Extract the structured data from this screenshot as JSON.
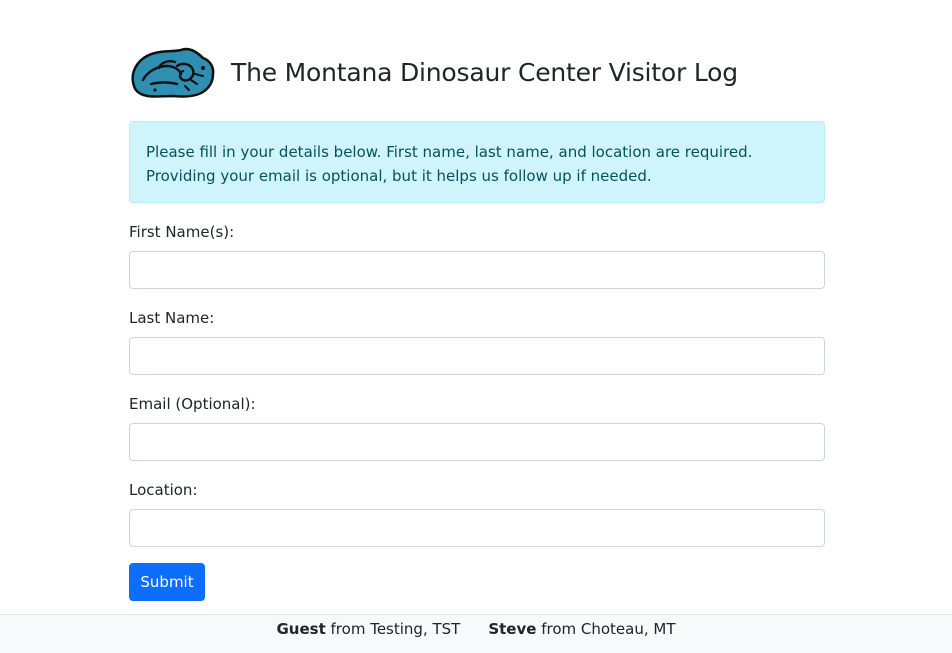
{
  "header": {
    "title": "The Montana Dinosaur Center Visitor Log",
    "logo_icon": "dinosaur-fossil-icon"
  },
  "alert": {
    "text": "Please fill in your details below. First name, last name, and location are required. Providing your email is optional, but it helps us follow up if needed."
  },
  "form": {
    "fields": [
      {
        "label": "First Name(s):",
        "value": ""
      },
      {
        "label": "Last Name:",
        "value": ""
      },
      {
        "label": "Email (Optional):",
        "value": ""
      },
      {
        "label": "Location:",
        "value": ""
      }
    ],
    "submit_label": "Submit"
  },
  "footer": {
    "visitors": [
      {
        "name": "Guest",
        "from": "from Testing, TST"
      },
      {
        "name": "Steve",
        "from": "from Choteau, MT"
      }
    ]
  },
  "colors": {
    "primary": "#0d6efd",
    "alert_bg": "#cff4fc",
    "alert_text": "#055160",
    "logo_fill": "#2e8fb3",
    "footer_bg": "#f8f9fa"
  }
}
